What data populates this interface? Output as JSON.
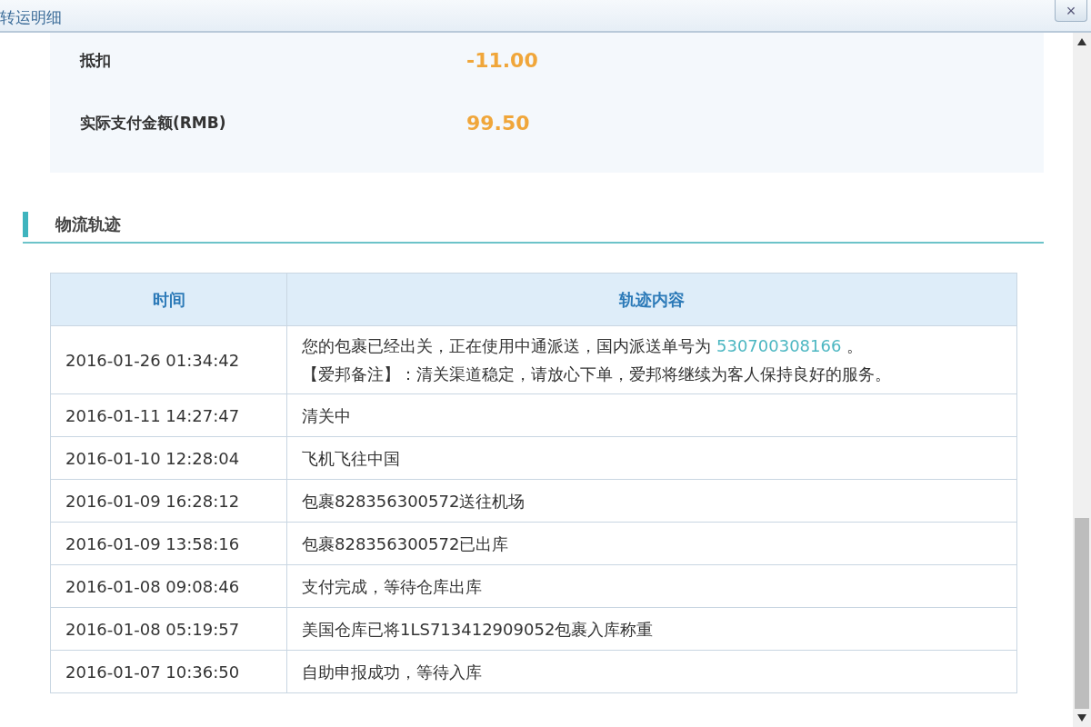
{
  "window": {
    "title": "转运明细",
    "close_label": "×"
  },
  "summary": [
    {
      "label": "抵扣",
      "value": "-11.00"
    },
    {
      "label": "实际支付金额(RMB)",
      "value": "99.50"
    }
  ],
  "section": {
    "title": "物流轨迹"
  },
  "table": {
    "columns": [
      "时间",
      "轨迹内容"
    ],
    "rows": [
      {
        "time": "2016-01-26 01:34:42",
        "content": "您的包裹已经出关，正在使用中通派送，国内派送单号为",
        "link": "530700308166",
        "content_after": "。",
        "note": "【爱邦备注】：清关渠道稳定，请放心下单，爱邦将继续为客人保持良好的服务。"
      },
      {
        "time": "2016-01-11 14:27:47",
        "content": "清关中"
      },
      {
        "time": "2016-01-10 12:28:04",
        "content": "飞机飞往中国"
      },
      {
        "time": "2016-01-09 16:28:12",
        "content": "包裹828356300572送往机场"
      },
      {
        "time": "2016-01-09 13:58:16",
        "content": "包裹828356300572已出库"
      },
      {
        "time": "2016-01-08 09:08:46",
        "content": "支付完成，等待仓库出库"
      },
      {
        "time": "2016-01-08 05:19:57",
        "content": "美国仓库已将1LS713412909052包裹入库称重"
      },
      {
        "time": "2016-01-07 10:36:50",
        "content": "自助申报成功，等待入库"
      }
    ]
  }
}
